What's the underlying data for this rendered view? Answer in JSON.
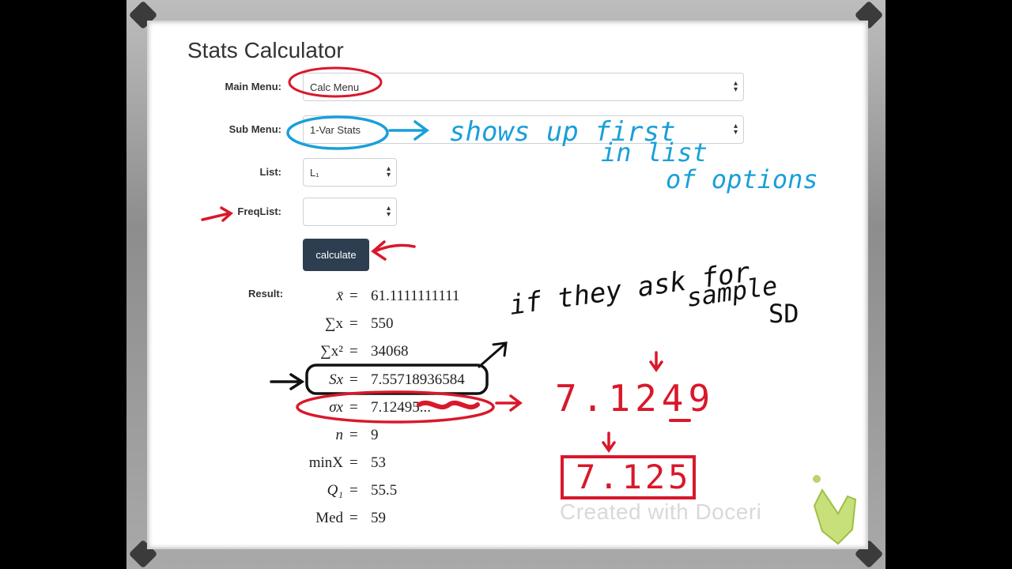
{
  "page": {
    "title": "Stats Calculator",
    "main_menu": {
      "label": "Main Menu:",
      "value": "Calc Menu"
    },
    "sub_menu": {
      "label": "Sub Menu:",
      "value": "1-Var Stats"
    },
    "list": {
      "label": "List:",
      "value": "L₁"
    },
    "freq_list": {
      "label": "FreqList:",
      "value": ""
    },
    "calculate_label": "calculate",
    "result_label": "Result:",
    "results": [
      {
        "symbol": "x̄",
        "value": "61.1111111111"
      },
      {
        "symbol": "∑x",
        "value": "550"
      },
      {
        "symbol": "∑x²",
        "value": "34068"
      },
      {
        "symbol": "Sx",
        "value": "7.55718936584"
      },
      {
        "symbol": "σx",
        "value": "7.12495..."
      },
      {
        "symbol": "n",
        "value": "9"
      },
      {
        "symbol": "minX",
        "value": "53"
      },
      {
        "symbol": "Q₁",
        "value": "55.5"
      },
      {
        "symbol": "Med",
        "value": "59"
      }
    ]
  },
  "annotations": {
    "submenu_note_1": "shows up first",
    "submenu_note_2": "in list",
    "submenu_note_3": "of options",
    "sample_note_1": "if they ask for",
    "sample_note_2": "sample",
    "sample_note_3": "SD",
    "rounding_raw": "7.1249",
    "rounding_final": "7.125"
  },
  "watermark": "Created with Doceri",
  "colors": {
    "red_ink": "#d9182b",
    "blue_ink": "#1a9fd9",
    "black_ink": "#111111",
    "button": "#2c3e50"
  }
}
